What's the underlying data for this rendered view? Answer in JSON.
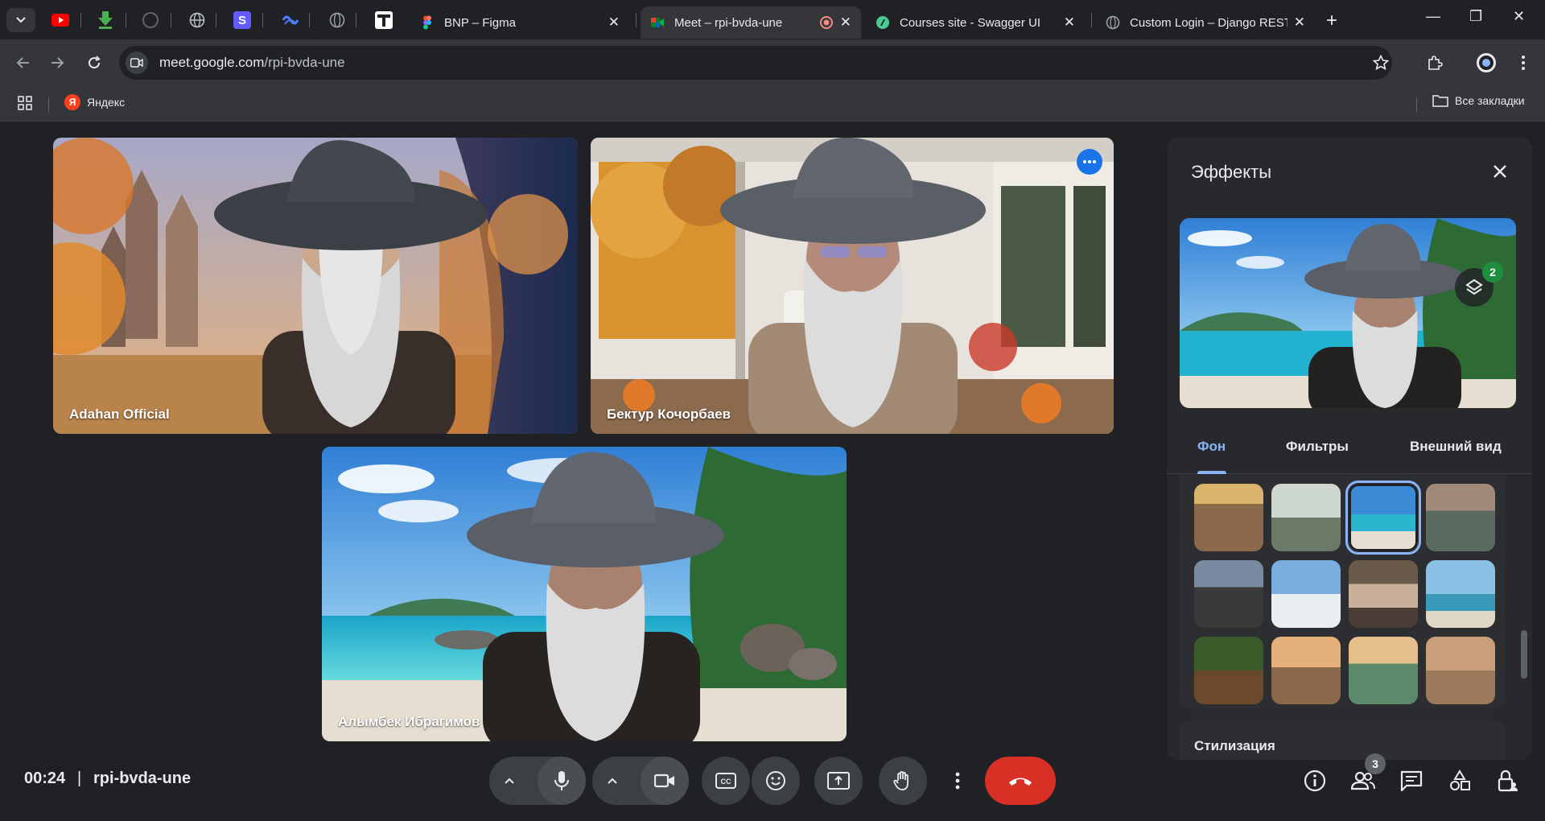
{
  "browser": {
    "tabs": [
      {
        "title": "BNP – Figma",
        "active": false
      },
      {
        "title": "Meet – rpi-bvda-une",
        "active": true
      },
      {
        "title": "Courses site - Swagger UI",
        "active": false
      },
      {
        "title": "Custom Login – Django REST",
        "active": false
      }
    ],
    "url_host": "meet.google.com",
    "url_path": "/rpi-bvda-une",
    "bookmarks": [
      {
        "label": "Яндекс"
      }
    ],
    "all_bookmarks_label": "Все закладки",
    "colors": {
      "frame": "#202124",
      "toolbar": "#35363a",
      "accent": "#8ab4f8"
    }
  },
  "meet": {
    "time": "00:24",
    "divider": "|",
    "code": "rpi-bvda-une",
    "participants": [
      {
        "name": "Adahan Official",
        "background": "castle-autumn"
      },
      {
        "name": "Бектур Кочорбаев",
        "background": "porch-autumn",
        "speaking": true
      },
      {
        "name": "Алымбек Ибрагимов",
        "background": "beach"
      }
    ],
    "people_count": "3",
    "colors": {
      "end_call": "#d93025",
      "speaking_outline": "#1a73e8"
    }
  },
  "effects": {
    "title": "Эффекты",
    "layers_count": "2",
    "tabs": [
      {
        "label": "Фон",
        "active": true
      },
      {
        "label": "Фильтры",
        "active": false
      },
      {
        "label": "Внешний вид",
        "active": false
      }
    ],
    "backgrounds": [
      {
        "name": "loft-bed"
      },
      {
        "name": "greenhouse"
      },
      {
        "name": "beach",
        "selected": true
      },
      {
        "name": "zen-garden"
      },
      {
        "name": "glass-house"
      },
      {
        "name": "seaside-room"
      },
      {
        "name": "pergola"
      },
      {
        "name": "sea-arch"
      },
      {
        "name": "forest-cafe"
      },
      {
        "name": "camper-sunset"
      },
      {
        "name": "mountain-lake"
      },
      {
        "name": "desert-ruins"
      }
    ],
    "stylization_label": "Стилизация"
  }
}
